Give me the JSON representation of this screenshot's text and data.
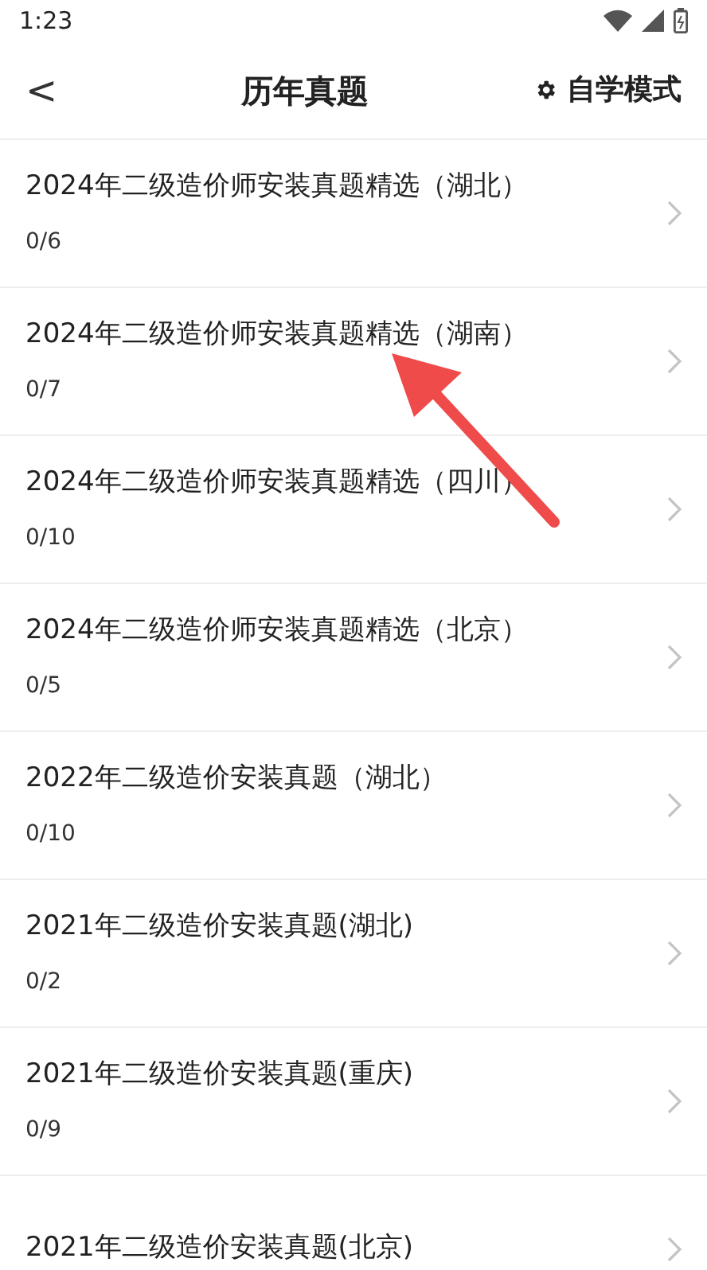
{
  "status_bar": {
    "time": "1:23"
  },
  "header": {
    "back": "<",
    "title": "历年真题",
    "mode_label": "自学模式"
  },
  "items": [
    {
      "title": "2024年二级造价师安装真题精选（湖北）",
      "progress": "0/6"
    },
    {
      "title": "2024年二级造价师安装真题精选（湖南）",
      "progress": "0/7"
    },
    {
      "title": "2024年二级造价师安装真题精选（四川）",
      "progress": "0/10"
    },
    {
      "title": "2024年二级造价师安装真题精选（北京）",
      "progress": "0/5"
    },
    {
      "title": "2022年二级造价安装真题（湖北）",
      "progress": "0/10"
    },
    {
      "title": "2021年二级造价安装真题(湖北)",
      "progress": "0/2"
    },
    {
      "title": "2021年二级造价安装真题(重庆)",
      "progress": "0/9"
    },
    {
      "title": "2021年二级造价安装真题(北京)"
    }
  ]
}
